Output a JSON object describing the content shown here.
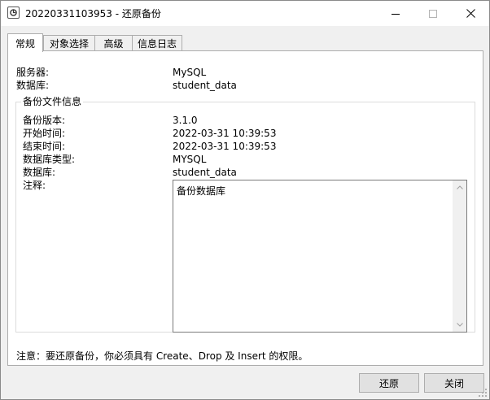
{
  "window": {
    "title": "20220331103953 - 还原备份"
  },
  "tabs": [
    {
      "label": "常规",
      "active": true
    },
    {
      "label": "对象选择",
      "active": false
    },
    {
      "label": "高级",
      "active": false
    },
    {
      "label": "信息日志",
      "active": false
    }
  ],
  "general": {
    "server_label": "服务器:",
    "server_value": "MySQL",
    "database_label": "数据库:",
    "database_value": "student_data"
  },
  "backup_info": {
    "legend": "备份文件信息",
    "version_label": "备份版本:",
    "version_value": "3.1.0",
    "start_label": "开始时间:",
    "start_value": "2022-03-31 10:39:53",
    "end_label": "结束时间:",
    "end_value": "2022-03-31 10:39:53",
    "db_type_label": "数据库类型:",
    "db_type_value": "MYSQL",
    "database_label": "数据库:",
    "database_value": "student_data",
    "comment_label": "注释:",
    "comment_value": "备份数据库"
  },
  "notice": "注意：要还原备份，你必须具有 Create、Drop 及 Insert 的权限。",
  "buttons": {
    "restore": "还原",
    "close": "关闭"
  },
  "icons": {
    "app": "navicat-app-icon",
    "minimize": "minimize-icon",
    "maximize": "maximize-icon",
    "close": "close-icon"
  }
}
